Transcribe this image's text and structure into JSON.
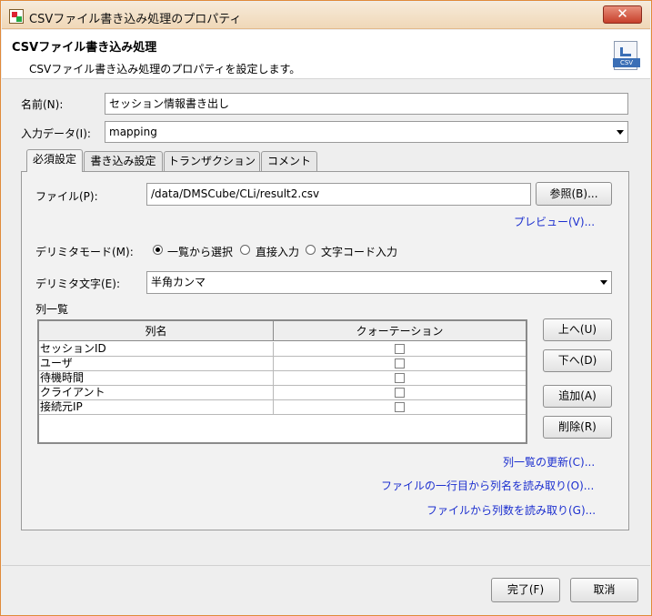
{
  "window": {
    "title": "CSVファイル書き込み処理のプロパティ",
    "close_glyph": "✕"
  },
  "header": {
    "title": "CSVファイル書き込み処理",
    "description": "CSVファイル書き込み処理のプロパティを設定します。",
    "icon_badge": "CSV"
  },
  "form": {
    "name_label": "名前(N):",
    "name_value": "セッション情報書き出し",
    "input_label": "入力データ(I):",
    "input_value": "mapping"
  },
  "tabs": [
    "必須設定",
    "書き込み設定",
    "トランザクション",
    "コメント"
  ],
  "required": {
    "file_label": "ファイル(P):",
    "file_value": "/data/DMSCube/CLi/result2.csv",
    "browse_label": "参照(B)...",
    "preview_link": "プレビュー(V)...",
    "delimiter_mode_label": "デリミタモード(M):",
    "delimiter_modes": [
      {
        "label": "一覧から選択",
        "checked": true
      },
      {
        "label": "直接入力",
        "checked": false
      },
      {
        "label": "文字コード入力",
        "checked": false
      }
    ],
    "delimiter_char_label": "デリミタ文字(E):",
    "delimiter_char_value": "半角カンマ",
    "column_list_label": "列一覧",
    "columns": {
      "headers": [
        "列名",
        "クォーテーション"
      ],
      "rows": [
        {
          "name": "セッションID",
          "quote": false
        },
        {
          "name": "ユーザ",
          "quote": false
        },
        {
          "name": "待機時間",
          "quote": false
        },
        {
          "name": "クライアント",
          "quote": false
        },
        {
          "name": "接続元IP",
          "quote": false
        }
      ]
    },
    "buttons": {
      "up": "上へ(U)",
      "down": "下へ(D)",
      "add": "追加(A)",
      "delete": "削除(R)"
    },
    "links": {
      "refresh": "列一覧の更新(C)...",
      "read_names": "ファイルの一行目から列名を読み取り(O)...",
      "read_count": "ファイルから列数を読み取り(G)..."
    }
  },
  "footer": {
    "ok": "完了(F)",
    "cancel": "取消"
  }
}
